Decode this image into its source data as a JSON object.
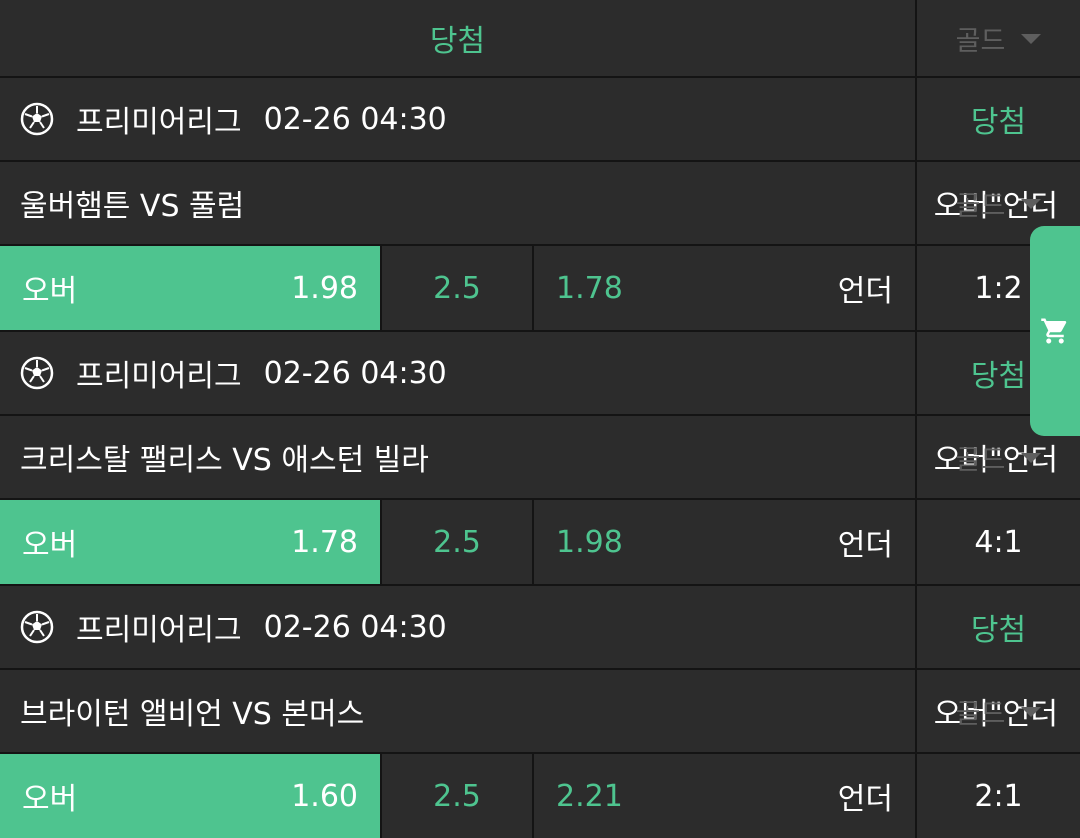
{
  "header": {
    "title": "당첨",
    "filter": "골드"
  },
  "cart": {
    "icon": "cart-icon"
  },
  "colors": {
    "accent": "#4ec48f",
    "row_bg": "#2c2c2c",
    "separator": "#141414",
    "muted": "#5e5e5e"
  },
  "matches": [
    {
      "league": "프리미어리그",
      "datetime": "02-26 04:30",
      "status": "당첨",
      "teams": "울버햄튼 VS 풀럼",
      "market": "오버\"언더",
      "filter": "골드",
      "over_label": "오버",
      "over_odds": "1.98",
      "line": "2.5",
      "under_odds": "1.78",
      "under_label": "언더",
      "score": "1:2"
    },
    {
      "league": "프리미어리그",
      "datetime": "02-26 04:30",
      "status": "당첨",
      "teams": "크리스탈 팰리스 VS 애스턴 빌라",
      "market": "오버\"언더",
      "filter": "골드",
      "over_label": "오버",
      "over_odds": "1.78",
      "line": "2.5",
      "under_odds": "1.98",
      "under_label": "언더",
      "score": "4:1"
    },
    {
      "league": "프리미어리그",
      "datetime": "02-26 04:30",
      "status": "당첨",
      "teams": "브라이턴 앨비언 VS 본머스",
      "market": "오버\"언더",
      "filter": "골드",
      "over_label": "오버",
      "over_odds": "1.60",
      "line": "2.5",
      "under_odds": "2.21",
      "under_label": "언더",
      "score": "2:1"
    }
  ]
}
